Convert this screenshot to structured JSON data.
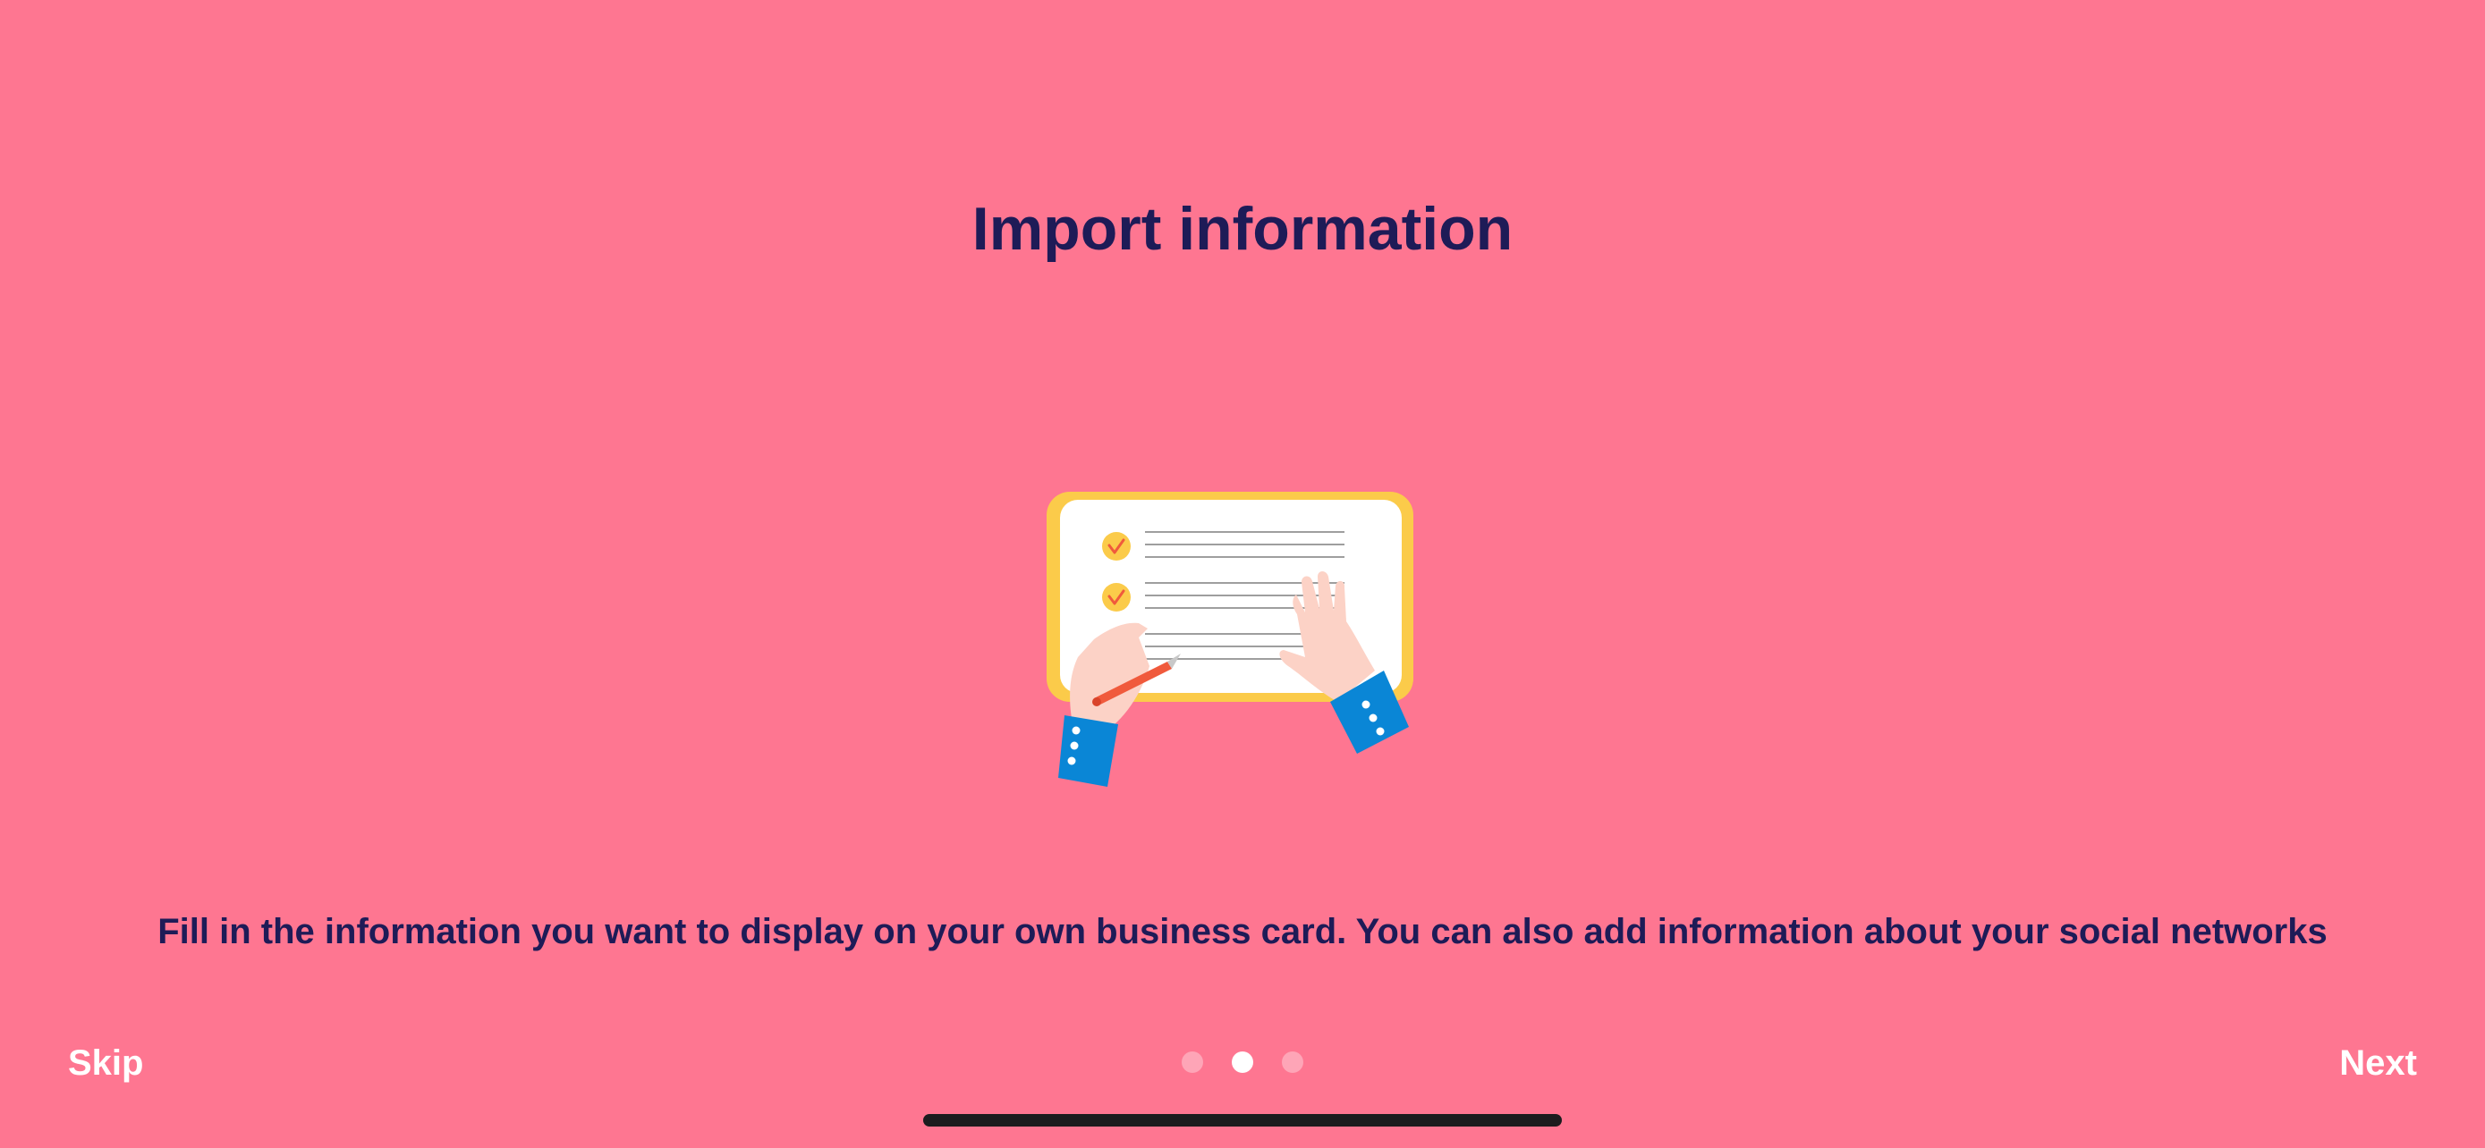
{
  "onboarding": {
    "title": "Import information",
    "description": "Fill in the information you want to display on your own business card. You can also add information about your social networks",
    "illustration_icon": "checklist-hands-illustration"
  },
  "navigation": {
    "skip_label": "Skip",
    "next_label": "Next",
    "page_indicator": {
      "total_pages": 3,
      "current_page": 2
    }
  },
  "colors": {
    "background": "#FE7691",
    "title_text": "#1E1B57",
    "card_border": "#FBCB4A",
    "sleeve": "#0A86D6",
    "skin": "#FCD2C6"
  }
}
